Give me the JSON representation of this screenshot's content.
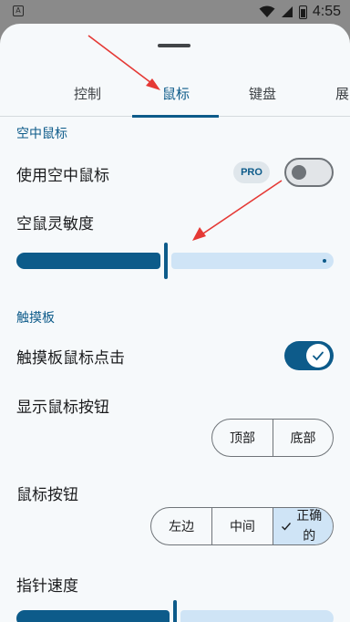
{
  "status_bar": {
    "time": "4:55",
    "left_icon": "A"
  },
  "tabs": [
    {
      "label": "控制"
    },
    {
      "label": "鼠标"
    },
    {
      "label": "键盘"
    },
    {
      "label": "展"
    }
  ],
  "air_mouse": {
    "section_title": "空中鼠标",
    "use_label": "使用空中鼠标",
    "pro_badge": "PRO",
    "use_enabled": false,
    "sensitivity_label": "空鼠灵敏度",
    "sensitivity_fraction": 0.47
  },
  "touchpad": {
    "section_title": "触摸板",
    "click_label": "触摸板鼠标点击",
    "click_enabled": true,
    "show_buttons_label": "显示鼠标按钮",
    "position_options": [
      "顶部",
      "底部"
    ],
    "mouse_buttons_label": "鼠标按钮",
    "button_options": [
      "左边",
      "中间",
      "正确的"
    ],
    "button_selected": "正确的",
    "pointer_speed_label": "指针速度",
    "pointer_speed_fraction": 0.5
  },
  "colors": {
    "accent": "#0d5b8a",
    "track_inactive": "#cfe4f6",
    "annotation_arrow": "#e53935"
  }
}
